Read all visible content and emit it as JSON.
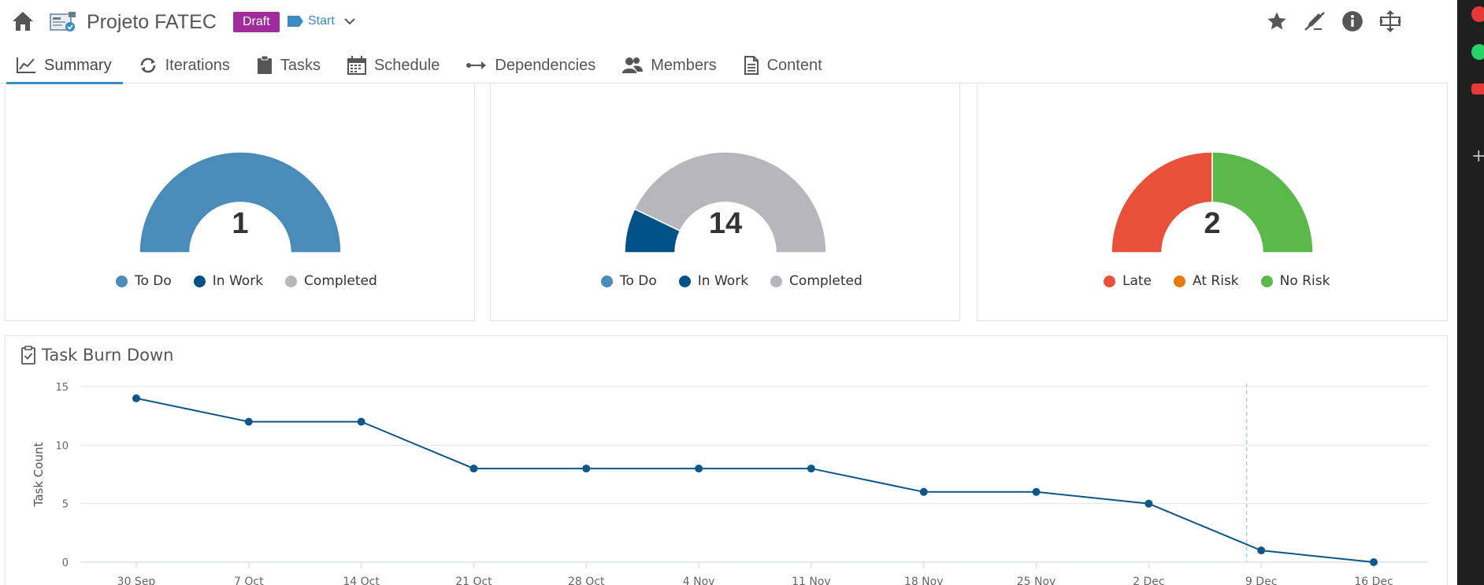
{
  "header": {
    "title": "Projeto FATEC",
    "status_badge": "Draft",
    "start_label": "Start"
  },
  "tabs": [
    {
      "label": "Summary",
      "icon": "line-chart-icon"
    },
    {
      "label": "Iterations",
      "icon": "cycle-icon"
    },
    {
      "label": "Tasks",
      "icon": "clipboard-icon"
    },
    {
      "label": "Schedule",
      "icon": "calendar-icon"
    },
    {
      "label": "Dependencies",
      "icon": "dependency-arrow-icon"
    },
    {
      "label": "Members",
      "icon": "users-icon"
    },
    {
      "label": "Content",
      "icon": "document-icon"
    }
  ],
  "gauges": [
    {
      "value": "1",
      "slices": [
        {
          "name": "To Do",
          "value": 1,
          "color": "#4a8cb9"
        },
        {
          "name": "In Work",
          "value": 0,
          "color": "#005286"
        },
        {
          "name": "Completed",
          "value": 0,
          "color": "#b7b7bb"
        }
      ],
      "legend": [
        "To Do",
        "In Work",
        "Completed"
      ]
    },
    {
      "value": "14",
      "slices": [
        {
          "name": "To Do",
          "value": 0,
          "color": "#4a8cb9"
        },
        {
          "name": "In Work",
          "value": 2,
          "color": "#005286"
        },
        {
          "name": "Completed",
          "value": 12,
          "color": "#b7b7bb"
        }
      ],
      "legend": [
        "To Do",
        "In Work",
        "Completed"
      ]
    },
    {
      "value": "2",
      "slices": [
        {
          "name": "Late",
          "value": 1,
          "color": "#e8503a"
        },
        {
          "name": "At Risk",
          "value": 0,
          "color": "#e87a0c"
        },
        {
          "name": "No Risk",
          "value": 1,
          "color": "#5bb84b"
        }
      ],
      "legend": [
        "Late",
        "At Risk",
        "No Risk"
      ]
    }
  ],
  "burn_down": {
    "title": "Task Burn Down"
  },
  "chart_data": {
    "type": "line",
    "title": "Task Burn Down",
    "ylabel": "Task Count",
    "xlabel": "",
    "ylim": [
      0,
      15
    ],
    "yticks": [
      0,
      5,
      10,
      15
    ],
    "categories": [
      "30 Sep",
      "7 Oct",
      "14 Oct",
      "21 Oct",
      "28 Oct",
      "4 Nov",
      "11 Nov",
      "18 Nov",
      "25 Nov",
      "2 Dec",
      "9 Dec",
      "16 Dec"
    ],
    "series": [
      {
        "values": [
          14,
          12,
          12,
          8,
          8,
          8,
          8,
          6,
          6,
          5,
          1,
          0
        ],
        "color": "#0d5788"
      }
    ],
    "today_marker": {
      "after_category_index": 9,
      "fraction": 0.87,
      "color": "#a8d1e3"
    },
    "grid": true
  }
}
